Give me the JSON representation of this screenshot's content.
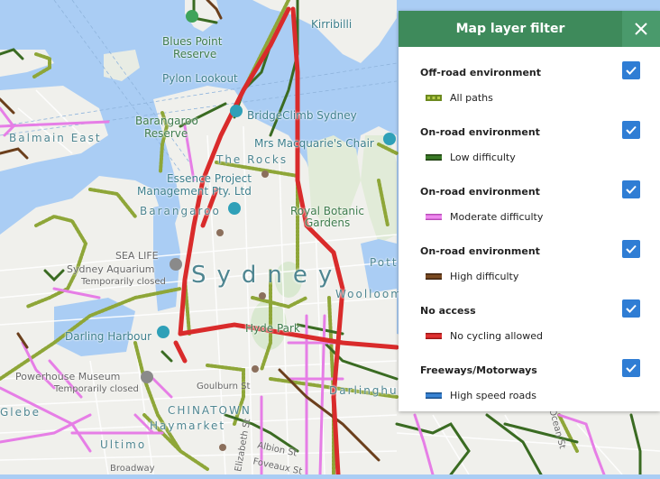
{
  "panel": {
    "title": "Map layer filter",
    "close_icon": "close-icon",
    "sections": [
      {
        "title": "Off-road environment",
        "label": "All paths",
        "checked": true,
        "color": "#7a9a2a",
        "pattern": "dotted"
      },
      {
        "title": "On-road environment",
        "label": "Low difficulty",
        "checked": true,
        "color": "#3a6b22",
        "pattern": "solid"
      },
      {
        "title": "On-road environment",
        "label": "Moderate difficulty",
        "checked": true,
        "color": "#e67ee6",
        "pattern": "solid"
      },
      {
        "title": "On-road environment",
        "label": "High difficulty",
        "checked": true,
        "color": "#6b3f1c",
        "pattern": "solid"
      },
      {
        "title": "No access",
        "label": "No cycling allowed",
        "checked": true,
        "color": "#d92b2b",
        "pattern": "solid"
      },
      {
        "title": "Freeways/Motorways",
        "label": "High speed roads",
        "checked": true,
        "color": "#3a7ccc",
        "pattern": "solid"
      }
    ]
  },
  "map": {
    "labels": {
      "kirribilli": "Kirribilli",
      "blues_point": "Blues Point",
      "reserve1": "Reserve",
      "pylon": "Pylon Lookout",
      "barangaroo_reserve": "Barangaroo",
      "reserve2": "Reserve",
      "bridgeclimb": "BridgeClimb Sydney",
      "mrs_macquarie": "Mrs Macquarie's Chair",
      "balmain_east": "Balmain East",
      "the_rocks": "The Rocks",
      "essence1": "Essence Project",
      "essence2": "Management Pty. Ltd",
      "barangaroo": "Barangaroo",
      "royal_botanic1": "Royal Botanic",
      "royal_botanic2": "Gardens",
      "sea_life": "SEA LIFE",
      "sydney_aquarium": "Sydney Aquarium",
      "temp_closed1": "Temporarily closed",
      "sydney": "Sydney",
      "potts": "Pott",
      "woolloomooloo": "Woolloom",
      "hyde_park": "Hyde Park",
      "darling_harbour": "Darling Harbour",
      "powerhouse": "Powerhouse Museum",
      "temp_closed2": "Temporarily closed",
      "goulburn": "Goulburn St",
      "chinatown": "CHINATOWN",
      "haymarket": "Haymarket",
      "darlinghurst": "Darlinghurst",
      "glebe": "Glebe",
      "ultimo": "Ultimo",
      "broadway": "Broadway",
      "albion": "Albion St",
      "foveaux": "Foveaux St",
      "elizabeth": "Elizabeth St",
      "ocean": "Ocean St"
    }
  }
}
